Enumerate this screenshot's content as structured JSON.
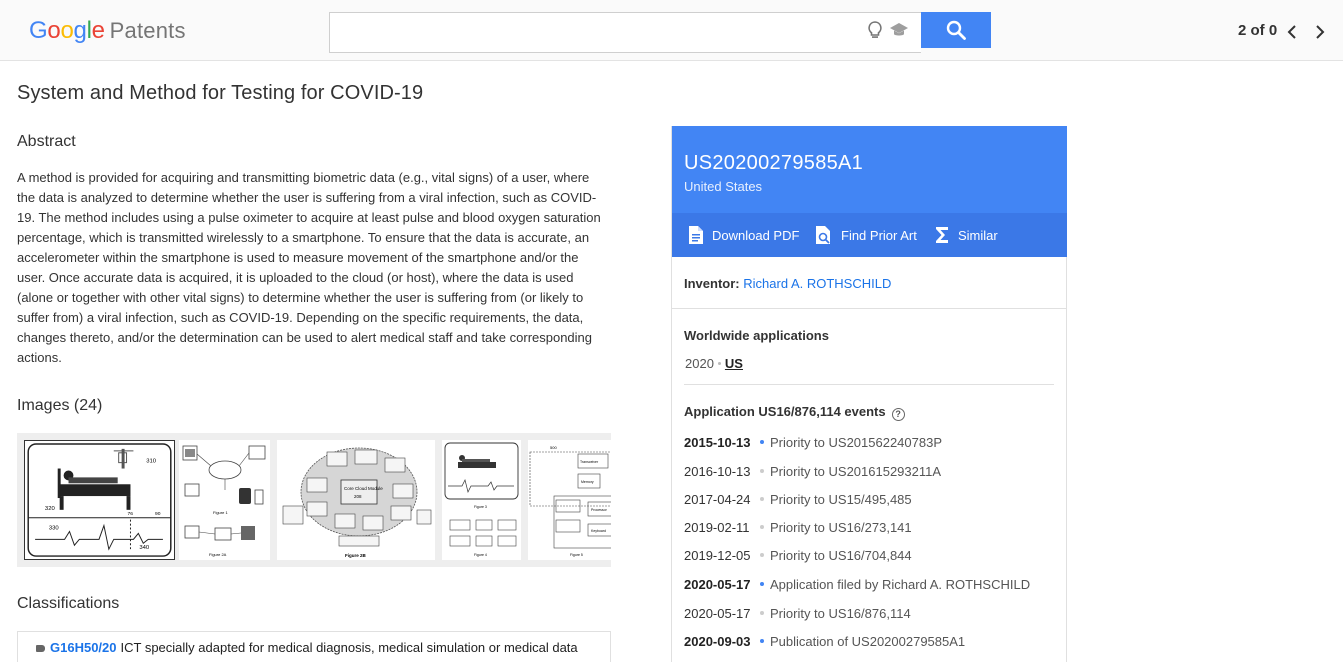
{
  "header": {
    "brand_letters": [
      {
        "ch": "G",
        "color": "#4285f4"
      },
      {
        "ch": "o",
        "color": "#ea4335"
      },
      {
        "ch": "o",
        "color": "#fbbc05"
      },
      {
        "ch": "g",
        "color": "#4285f4"
      },
      {
        "ch": "l",
        "color": "#34a853"
      },
      {
        "ch": "e",
        "color": "#ea4335"
      }
    ],
    "product": "Patents",
    "search_value": "",
    "pager": "2 of 0"
  },
  "colors": {
    "accent": "#4285f4",
    "link": "#1a73e8"
  },
  "page": {
    "title": "System and Method for Testing for COVID-19",
    "abstract_heading": "Abstract",
    "abstract": "A method is provided for acquiring and transmitting biometric data (e.g., vital signs) of a user, where the data is analyzed to determine whether the user is suffering from a viral infection, such as COVID-19. The method includes using a pulse oximeter to acquire at least pulse and blood oxygen saturation percentage, which is transmitted wirelessly to a smartphone. To ensure that the data is accurate, an accelerometer within the smartphone is used to measure movement of the smartphone and/or the user. Once accurate data is acquired, it is uploaded to the cloud (or host), where the data is used (alone or together with other vital signs) to determine whether the user is suffering from (or likely to suffer from) a viral infection, such as COVID-19. Depending on the specific requirements, the data, changes thereto, and/or the determination can be used to alert medical staff and take corresponding actions.",
    "images_heading": "Images (24)",
    "classifications_heading": "Classifications",
    "classification": {
      "code": "G16H50/20",
      "text": "ICT specially adapted for medical diagnosis, medical simulation or medical data"
    }
  },
  "card": {
    "publication_number": "US20200279585A1",
    "country": "United States",
    "actions": {
      "download": "Download PDF",
      "prior_art": "Find Prior Art",
      "similar": "Similar"
    },
    "inventor_label": "Inventor:",
    "inventor_name": "Richard A. ROTHSCHILD",
    "worldwide_title": "Worldwide applications",
    "worldwide_year": "2020",
    "worldwide_country": "US",
    "events_title": "Application US16/876,114 events",
    "events": [
      {
        "date": "2015-10-13",
        "desc": "Priority to US201562240783P",
        "primary": true
      },
      {
        "date": "2016-10-13",
        "desc": "Priority to US201615293211A",
        "primary": false
      },
      {
        "date": "2017-04-24",
        "desc": "Priority to US15/495,485",
        "primary": false
      },
      {
        "date": "2019-02-11",
        "desc": "Priority to US16/273,141",
        "primary": false
      },
      {
        "date": "2019-12-05",
        "desc": "Priority to US16/704,844",
        "primary": false
      },
      {
        "date": "2020-05-17",
        "desc": "Application filed by Richard A. ROTHSCHILD",
        "primary": true
      },
      {
        "date": "2020-05-17",
        "desc": "Priority to US16/876,114",
        "primary": false
      },
      {
        "date": "2020-09-03",
        "desc": "Publication of US20200279585A1",
        "primary": true
      }
    ]
  },
  "figures": {
    "fig1": {
      "label_a": "310",
      "label_b": "320",
      "label_c": "330",
      "label_d": "340",
      "label_e": "76",
      "label_f": "90"
    },
    "fig2": {
      "caption_a": "Figure 1",
      "caption_b": "Figure 2A"
    },
    "fig3": {
      "caption": "Figure 2B",
      "center": "Core Cloud Module",
      "center_num": "208"
    },
    "fig4": {
      "caption": "Figure 3",
      "caption_b": "Figure 4"
    },
    "fig5": {
      "caption": "Figure 5",
      "label_top": "500",
      "box_a": "Transceiver",
      "box_b": "Processor",
      "box_c": "Memory",
      "box_d": "Keyboard"
    }
  }
}
